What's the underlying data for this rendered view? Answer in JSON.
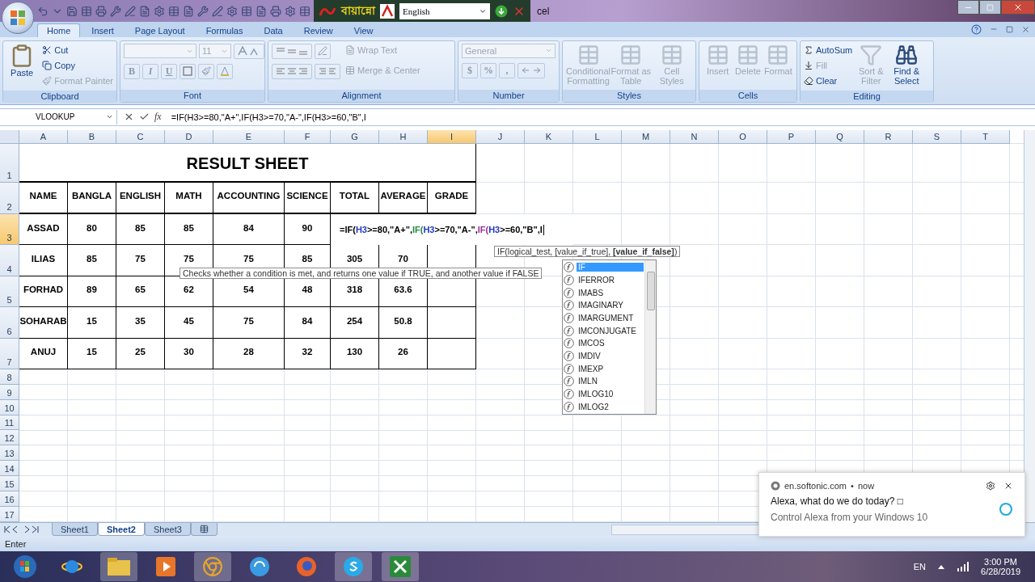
{
  "title_bar": {
    "keyboard_logo": "বায়ান্নো",
    "language": "English",
    "title": "cel"
  },
  "tabs": [
    {
      "label": "Home",
      "selected": true
    },
    {
      "label": "Insert",
      "selected": false
    },
    {
      "label": "Page Layout",
      "selected": false
    },
    {
      "label": "Formulas",
      "selected": false
    },
    {
      "label": "Data",
      "selected": false
    },
    {
      "label": "Review",
      "selected": false
    },
    {
      "label": "View",
      "selected": false
    }
  ],
  "ribbon": {
    "clipboard": {
      "label": "Clipboard",
      "paste": {
        "label": "Paste",
        "disabled": false
      },
      "items": [
        {
          "label": "Cut",
          "disabled": false
        },
        {
          "label": "Copy",
          "disabled": false
        },
        {
          "label": "Format Painter",
          "disabled": true
        }
      ]
    },
    "font": {
      "label": "Font",
      "size": "11",
      "styles": [
        "B",
        "I",
        "U"
      ]
    },
    "alignment": {
      "label": "Alignment",
      "wrap": {
        "label": "Wrap Text",
        "disabled": true
      },
      "merge": {
        "label": "Merge & Center",
        "disabled": true
      }
    },
    "number": {
      "label": "Number",
      "format": "General",
      "symbols": [
        "$",
        "%",
        ","
      ]
    },
    "styles": {
      "label": "Styles",
      "items": [
        {
          "label": "Conditional Formatting",
          "disabled": true
        },
        {
          "label": "Format as Table",
          "disabled": true
        },
        {
          "label": "Cell Styles",
          "disabled": true
        }
      ]
    },
    "cells": {
      "label": "Cells",
      "items": [
        {
          "label": "Insert",
          "disabled": true
        },
        {
          "label": "Delete",
          "disabled": true
        },
        {
          "label": "Format",
          "disabled": true
        }
      ]
    },
    "editing": {
      "label": "Editing",
      "small": [
        {
          "label": "AutoSum",
          "disabled": false
        },
        {
          "label": "Fill",
          "disabled": true
        },
        {
          "label": "Clear",
          "disabled": false
        }
      ],
      "large": [
        {
          "label": "Sort & Filter",
          "disabled": true
        },
        {
          "label": "Find & Select",
          "disabled": false
        }
      ]
    }
  },
  "formula_bar": {
    "name_box": "VLOOKUP",
    "fx": "fx",
    "formula": "=IF(H3>=80,\"A+\",IF(H3>=70,\"A-\",IF(H3>=60,\"B\",I"
  },
  "sheet": {
    "columns": [
      {
        "label": "A",
        "selected": false
      },
      {
        "label": "B",
        "selected": false
      },
      {
        "label": "C",
        "selected": false
      },
      {
        "label": "D",
        "selected": false
      },
      {
        "label": "E",
        "selected": false
      },
      {
        "label": "F",
        "selected": false
      },
      {
        "label": "G",
        "selected": false
      },
      {
        "label": "H",
        "selected": false
      },
      {
        "label": "I",
        "selected": true
      },
      {
        "label": "J",
        "selected": false
      },
      {
        "label": "K",
        "selected": false
      },
      {
        "label": "L",
        "selected": false
      },
      {
        "label": "M",
        "selected": false
      },
      {
        "label": "N",
        "selected": false
      },
      {
        "label": "O",
        "selected": false
      },
      {
        "label": "P",
        "selected": false
      },
      {
        "label": "Q",
        "selected": false
      },
      {
        "label": "R",
        "selected": false
      },
      {
        "label": "S",
        "selected": false
      },
      {
        "label": "T",
        "selected": false
      }
    ],
    "rows": [
      {
        "label": "1",
        "selected": false
      },
      {
        "label": "2",
        "selected": false
      },
      {
        "label": "3",
        "selected": true
      },
      {
        "label": "4",
        "selected": false
      },
      {
        "label": "5",
        "selected": false
      },
      {
        "label": "6",
        "selected": false
      },
      {
        "label": "7",
        "selected": false
      },
      {
        "label": "8",
        "selected": false
      },
      {
        "label": "9",
        "selected": false
      },
      {
        "label": "10",
        "selected": false
      },
      {
        "label": "11",
        "selected": false
      },
      {
        "label": "12",
        "selected": false
      },
      {
        "label": "13",
        "selected": false
      },
      {
        "label": "14",
        "selected": false
      },
      {
        "label": "15",
        "selected": false
      },
      {
        "label": "16",
        "selected": false
      },
      {
        "label": "17",
        "selected": false
      }
    ],
    "title": "RESULT SHEET",
    "headers": [
      "NAME",
      "BANGLA",
      "ENGLISH",
      "MATH",
      "ACCOUNTING",
      "SCIENCE",
      "TOTAL",
      "AVERAGE",
      "GRADE"
    ],
    "records": [
      {
        "cells": [
          "ASSAD",
          "80",
          "85",
          "85",
          "84",
          "90",
          null,
          null,
          null
        ]
      },
      {
        "cells": [
          "ILIAS",
          "85",
          "75",
          "75",
          "75",
          "85",
          "305",
          "70",
          null
        ]
      },
      {
        "cells": [
          "FORHAD",
          "89",
          "65",
          "62",
          "54",
          "48",
          "318",
          "63.6",
          null
        ]
      },
      {
        "cells": [
          "SOHARAB",
          "15",
          "35",
          "45",
          "75",
          "84",
          "254",
          "50.8",
          null
        ]
      },
      {
        "cells": [
          "ANUJ",
          "15",
          "25",
          "30",
          "28",
          "32",
          "130",
          "26",
          null
        ]
      }
    ],
    "editor": [
      {
        "text": "=IF(",
        "color": "#000000"
      },
      {
        "text": "H3",
        "color": "#2038c0"
      },
      {
        "text": ">=80,\"A+\",",
        "color": "#000000"
      },
      {
        "text": "IF(",
        "color": "#1f8a3a"
      },
      {
        "text": "H3",
        "color": "#2038c0"
      },
      {
        "text": ">=70,\"A-\",",
        "color": "#000000"
      },
      {
        "text": "IF(",
        "color": "#9b2f9b"
      },
      {
        "text": "H3",
        "color": "#2038c0"
      },
      {
        "text": ">=60,\"B\",I",
        "color": "#000000"
      }
    ]
  },
  "function_tip": "Checks whether a condition is met, and returns one value if TRUE, and another value if FALSE",
  "syntax_tip": "IF(logical_test, [value_if_true], **[value_if_false]**)",
  "autocomplete": [
    {
      "label": "IF",
      "selected": true
    },
    {
      "label": "IFERROR",
      "selected": false
    },
    {
      "label": "IMABS",
      "selected": false
    },
    {
      "label": "IMAGINARY",
      "selected": false
    },
    {
      "label": "IMARGUMENT",
      "selected": false
    },
    {
      "label": "IMCONJUGATE",
      "selected": false
    },
    {
      "label": "IMCOS",
      "selected": false
    },
    {
      "label": "IMDIV",
      "selected": false
    },
    {
      "label": "IMEXP",
      "selected": false
    },
    {
      "label": "IMLN",
      "selected": false
    },
    {
      "label": "IMLOG10",
      "selected": false
    },
    {
      "label": "IMLOG2",
      "selected": false
    }
  ],
  "sheet_tabs": [
    {
      "label": "Sheet1",
      "selected": false
    },
    {
      "label": "Sheet2",
      "selected": true
    },
    {
      "label": "Sheet3",
      "selected": false
    }
  ],
  "status_bar": {
    "mode": "Enter"
  },
  "notification": {
    "source": "en.softonic.com",
    "separator": "•",
    "time": "now",
    "title": "Alexa, what do we do today? □",
    "body": "Control Alexa from your Windows 10"
  },
  "tray": {
    "language": "EN",
    "time": "3:00 PM",
    "date": "6/28/2019"
  }
}
